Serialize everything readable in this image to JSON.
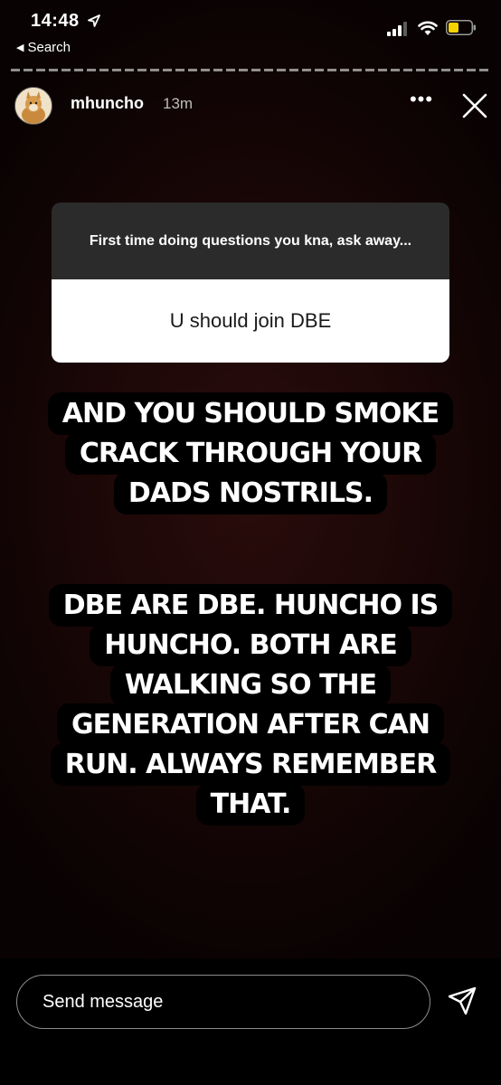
{
  "status_bar": {
    "time": "14:48",
    "back_label": "Search",
    "icons": [
      "location-arrow-icon",
      "cellular-signal-icon",
      "wifi-icon",
      "battery-icon"
    ],
    "battery_color": "#f5d300"
  },
  "header": {
    "username": "mhuncho",
    "timestamp": "13m"
  },
  "question_sticker": {
    "question": "First time doing questions you kna, ask away...",
    "answer": "U should join DBE"
  },
  "captions": [
    "AND YOU SHOULD SMOKE CRACK THROUGH YOUR DADS NOSTRILS.",
    "DBE ARE DBE. HUNCHO IS HUNCHO. BOTH ARE WALKING SO THE GENERATION AFTER CAN RUN. ALWAYS REMEMBER THAT."
  ],
  "reply": {
    "placeholder": "Send message"
  },
  "colors": {
    "background_center": "#2a0c0c",
    "background_edge": "#080202",
    "sticker_question_bg": "#2b2b2b",
    "sticker_answer_bg": "#ffffff",
    "caption_bg": "#000000"
  }
}
